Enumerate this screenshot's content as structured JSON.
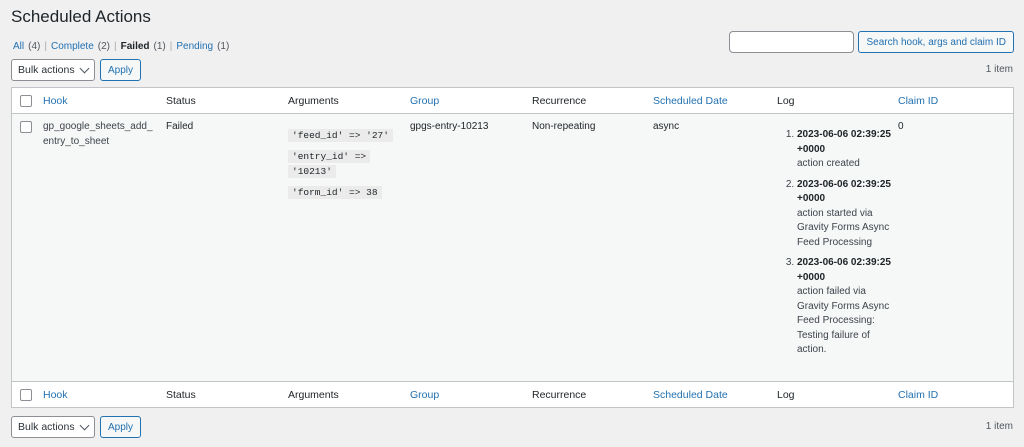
{
  "page": {
    "title": "Scheduled Actions"
  },
  "filters": {
    "all": {
      "label": "All",
      "count": "(4)"
    },
    "complete": {
      "label": "Complete",
      "count": "(2)"
    },
    "failed": {
      "label": "Failed",
      "count": "(1)"
    },
    "pending": {
      "label": "Pending",
      "count": "(1)"
    },
    "separator": "|"
  },
  "search": {
    "value": "",
    "button_label": "Search hook, args and claim ID"
  },
  "bulk": {
    "select_label": "Bulk actions",
    "apply_label": "Apply"
  },
  "items_count": "1 item",
  "columns": {
    "hook": "Hook",
    "status": "Status",
    "arguments": "Arguments",
    "group": "Group",
    "recurrence": "Recurrence",
    "scheduled_date": "Scheduled Date",
    "log": "Log",
    "claim_id": "Claim ID"
  },
  "rows": [
    {
      "hook": "gp_google_sheets_add_entry_to_sheet",
      "status": "Failed",
      "arguments": [
        "'feed_id' => '27'",
        "'entry_id' => '10213'",
        "'form_id' => 38"
      ],
      "group": "gpgs-entry-10213",
      "recurrence": "Non-repeating",
      "scheduled_date": "async",
      "log": [
        {
          "timestamp": "2023-06-06 02:39:25 +0000",
          "message": "action created"
        },
        {
          "timestamp": "2023-06-06 02:39:25 +0000",
          "message": "action started via Gravity Forms Async Feed Processing"
        },
        {
          "timestamp": "2023-06-06 02:39:25 +0000",
          "message": "action failed via Gravity Forms Async Feed Processing: Testing failure of action."
        }
      ],
      "claim_id": "0"
    }
  ],
  "colors": {
    "link": "#2271b1",
    "background": "#f0f0f1",
    "table_border": "#c3c4c7"
  }
}
